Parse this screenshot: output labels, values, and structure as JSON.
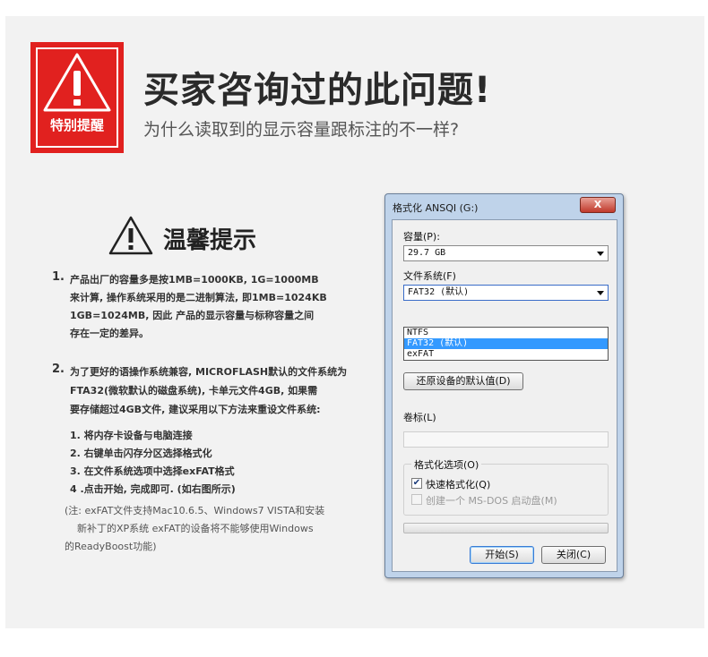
{
  "header": {
    "badge_text": "特别提醒",
    "title": "买家咨询过的此问题!",
    "subtitle": "为什么读取到的显示容量跟标注的不一样?"
  },
  "tips": {
    "title": "温馨提示",
    "item1": {
      "num": "1.",
      "lines": [
        "产品出厂的容量多是按1MB=1000KB, 1G=1000MB",
        "来计算, 操作系统采用的是二进制算法, 即1MB=1024KB",
        "1GB=1024MB, 因此 产品的显示容量与标称容量之间",
        "存在一定的差异。"
      ]
    },
    "item2": {
      "num": "2.",
      "lines": [
        "为了更好的语操作系统兼容, MICROFLASH默认的文件系统为",
        "FTA32(微软默认的磁盘系统),   卡单元文件4GB, 如果需",
        "要存储超过4GB文件, 建议采用以下方法来重设文件系统:"
      ]
    },
    "steps": [
      "1. 将内存卡设备与电脑连接",
      "2. 右键单击闪存分区选择格式化",
      "3. 在文件系统选项中选择exFAT格式",
      "4 .点击开始, 完成即可. (如右图所示)"
    ],
    "notes": [
      "(注: exFAT文件支持Mac10.6.5、Windows7 VISTA和安装",
      "新补丁的XP系统 exFAT的设备将不能够使用Windows",
      "的ReadyBoost功能)"
    ]
  },
  "dialog": {
    "title": "格式化 ANSQI (G:)",
    "close_label": "X",
    "capacity_label": "容量(P):",
    "capacity_value": "29.7 GB",
    "fs_label": "文件系统(F)",
    "fs_value": "FAT32 (默认)",
    "fs_options": [
      "NTFS",
      "FAT32 (默认)",
      "exFAT"
    ],
    "fs_selected_index": 1,
    "restore_button": "还原设备的默认值(D)",
    "volume_label": "卷标(L)",
    "volume_value": "",
    "options_legend": "格式化选项(O)",
    "quick_format_label": "快速格式化(Q)",
    "quick_format_checked": true,
    "msdos_label": "创建一个 MS-DOS 启动盘(M)",
    "msdos_checked": false,
    "progress": 0,
    "start_button": "开始(S)",
    "close_button": "关闭(C)"
  },
  "colors": {
    "badge_red": "#e1211f",
    "panel_bg": "#f2f2f2",
    "dialog_frame": "#bfd3ea",
    "selection_blue": "#3399ff"
  }
}
